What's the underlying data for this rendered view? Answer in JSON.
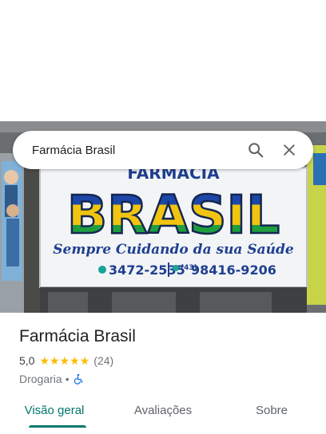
{
  "search": {
    "query": "Farmácia Brasil"
  },
  "photo": {
    "sign_top": "FARMÁCIA",
    "sign_main": "BRASIL",
    "slogan": "Sempre Cuidando da sua Saúde",
    "phone_1": "3472-2535",
    "phone_2_prefix": "(43)",
    "phone_2": "98416-9206"
  },
  "place": {
    "name": "Farmácia Brasil",
    "rating": "5,0",
    "stars": 5,
    "review_count": "(24)",
    "category": "Drogaria",
    "separator": "•"
  },
  "tabs": [
    {
      "label": "Visão geral",
      "active": true
    },
    {
      "label": "Avaliações",
      "active": false
    },
    {
      "label": "Sobre",
      "active": false
    }
  ],
  "colors": {
    "accent": "#00796b",
    "star": "#fbbc04"
  }
}
